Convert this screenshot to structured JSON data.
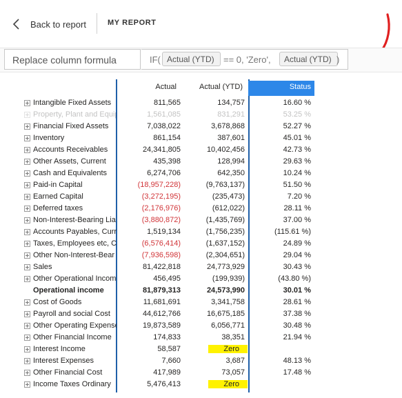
{
  "header": {
    "back_label": "Back to report",
    "report_title": "MY REPORT"
  },
  "formula": {
    "label": "Replace column formula",
    "prefix": "IF(",
    "chip1": "Actual (YTD)",
    "operator": "== 0, 'Zero',",
    "chip2": "Actual (YTD)",
    "suffix": ")"
  },
  "table": {
    "columns": [
      "Actual",
      "Actual (YTD)",
      "Status"
    ],
    "rows": [
      {
        "name": "Intangible Fixed Assets",
        "actual": "811,565",
        "ytd": "134,757",
        "status": "16.60 %"
      },
      {
        "name": "Property, Plant and Equip",
        "actual": "1,561,085",
        "ytd": "831,291",
        "status": "53.25 %"
      },
      {
        "name": "Financial Fixed Assets",
        "actual": "7,038,022",
        "ytd": "3,678,868",
        "status": "52.27 %"
      },
      {
        "name": "Inventory",
        "actual": "861,154",
        "ytd": "387,601",
        "status": "45.01 %"
      },
      {
        "name": "Accounts Receivables",
        "actual": "24,341,805",
        "ytd": "10,402,456",
        "status": "42.73 %"
      },
      {
        "name": "Other Assets, Current",
        "actual": "435,398",
        "ytd": "128,994",
        "status": "29.63 %"
      },
      {
        "name": "Cash and Equivalents",
        "actual": "6,274,706",
        "ytd": "642,350",
        "status": "10.24 %"
      },
      {
        "name": "Paid-in Capital",
        "actual": "(18,957,228)",
        "ytd": "(9,763,137)",
        "status": "51.50 %"
      },
      {
        "name": "Earned Capital",
        "actual": "(3,272,195)",
        "ytd": "(235,473)",
        "status": "7.20 %"
      },
      {
        "name": "Deferred taxes",
        "actual": "(2,176,976)",
        "ytd": "(612,022)",
        "status": "28.11 %"
      },
      {
        "name": "Non-Interest-Bearing Lia",
        "actual": "(3,880,872)",
        "ytd": "(1,435,769)",
        "status": "37.00 %"
      },
      {
        "name": "Accounts Payables, Curre",
        "actual": "1,519,134",
        "ytd": "(1,756,235)",
        "status": "(115.61 %)"
      },
      {
        "name": "Taxes, Employees etc, Cu",
        "actual": "(6,576,414)",
        "ytd": "(1,637,152)",
        "status": "24.89 %"
      },
      {
        "name": "Other Non-Interest-Bear",
        "actual": "(7,936,598)",
        "ytd": "(2,304,651)",
        "status": "29.04 %"
      },
      {
        "name": "Sales",
        "actual": "81,422,818",
        "ytd": "24,773,929",
        "status": "30.43 %"
      },
      {
        "name": "Other Operational Incom",
        "actual": "456,495",
        "ytd": "(199,939)",
        "status": "(43.80 %)"
      },
      {
        "name": "Operational income",
        "actual": "81,879,313",
        "ytd": "24,573,990",
        "status": "30.01 %"
      },
      {
        "name": "Cost of Goods",
        "actual": "11,681,691",
        "ytd": "3,341,758",
        "status": "28.61 %"
      },
      {
        "name": "Payroll and social Cost",
        "actual": "44,612,766",
        "ytd": "16,675,185",
        "status": "37.38 %"
      },
      {
        "name": "Other Operating Expense",
        "actual": "19,873,589",
        "ytd": "6,056,771",
        "status": "30.48 %"
      },
      {
        "name": "Other Financial Income",
        "actual": "174,833",
        "ytd": "38,351",
        "status": "21.94 %"
      },
      {
        "name": "Interest Income",
        "actual": "58,587",
        "ytd": "Zero",
        "status": ""
      },
      {
        "name": "Interest Expenses",
        "actual": "7,660",
        "ytd": "3,687",
        "status": "48.13 %"
      },
      {
        "name": "Other Financial Cost",
        "actual": "417,989",
        "ytd": "73,057",
        "status": "17.48 %"
      },
      {
        "name": "Income Taxes Ordinary",
        "actual": "5,476,413",
        "ytd": "Zero",
        "status": ""
      }
    ]
  },
  "colors": {
    "accent": "#2d87e8",
    "column_divider": "#1f5fa8",
    "negative": "#d13438",
    "highlight": "#fff200",
    "annotation_arrow": "#e02020"
  }
}
